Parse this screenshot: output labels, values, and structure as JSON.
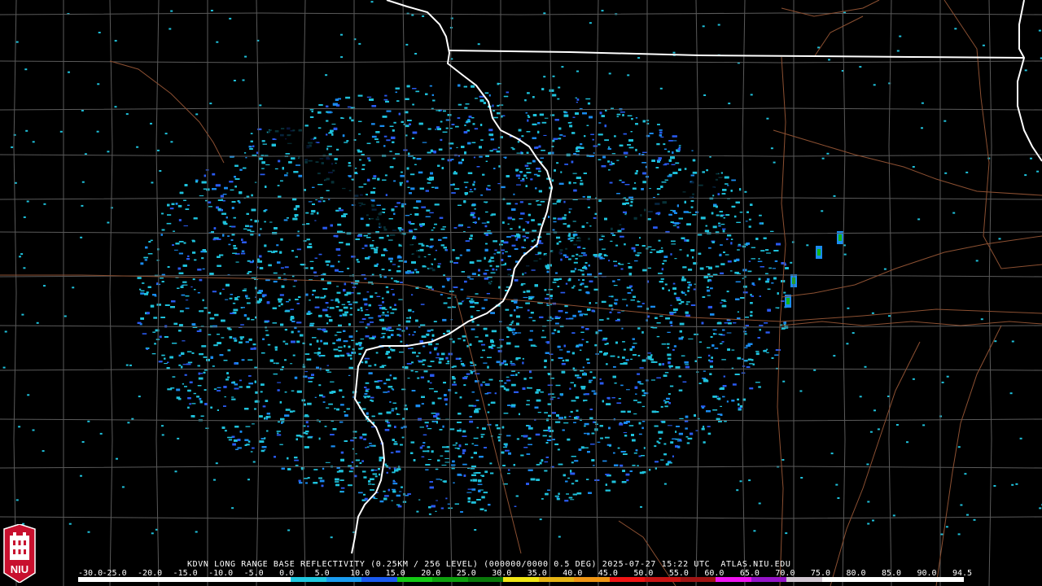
{
  "caption": "KDVN LONG RANGE BASE REFLECTIVITY (0.25KM / 256 LEVEL) (000000/0000 0.5 DEG) 2025-07-27 15:22 UTC  ATLAS.NIU.EDU",
  "scale_labels": [
    "-30.0",
    "-25.0",
    "-20.0",
    "-15.0",
    "-10.0",
    "-5.0",
    "0.0",
    "5.0",
    "10.0",
    "15.0",
    "20.0",
    "25.0",
    "30.0",
    "35.0",
    "40.0",
    "45.0",
    "50.0",
    "55.0",
    "60.0",
    "65.0",
    "70.0",
    "75.0",
    "80.0",
    "85.0",
    "90.0",
    "94.5"
  ],
  "scale_colors": [
    "#ffffff",
    "#ffffff",
    "#ffffff",
    "#ffffff",
    "#ffffff",
    "#ffffff",
    "#20c8e0",
    "#1a9cf0",
    "#1a5af0",
    "#14c814",
    "#0ea00e",
    "#0a780a",
    "#f0e614",
    "#e6b414",
    "#f09614",
    "#f01414",
    "#c81414",
    "#a01414",
    "#f014f0",
    "#9614c8",
    "#d2c8d2",
    "#ffffff",
    "#ffffff",
    "#ffffff",
    "#ffffff"
  ],
  "logo_text": "NIU",
  "colors": {
    "background": "#000000",
    "county_lines": "#5a5a5a",
    "state_lines": "#ffffff",
    "roads": "#8c5032",
    "echo_light": "#1fc2dc",
    "echo_mid": "#1a8cf0",
    "echo_strong": "#2a5af0",
    "echo_green": "#14b414"
  },
  "radar_site": "KDVN"
}
